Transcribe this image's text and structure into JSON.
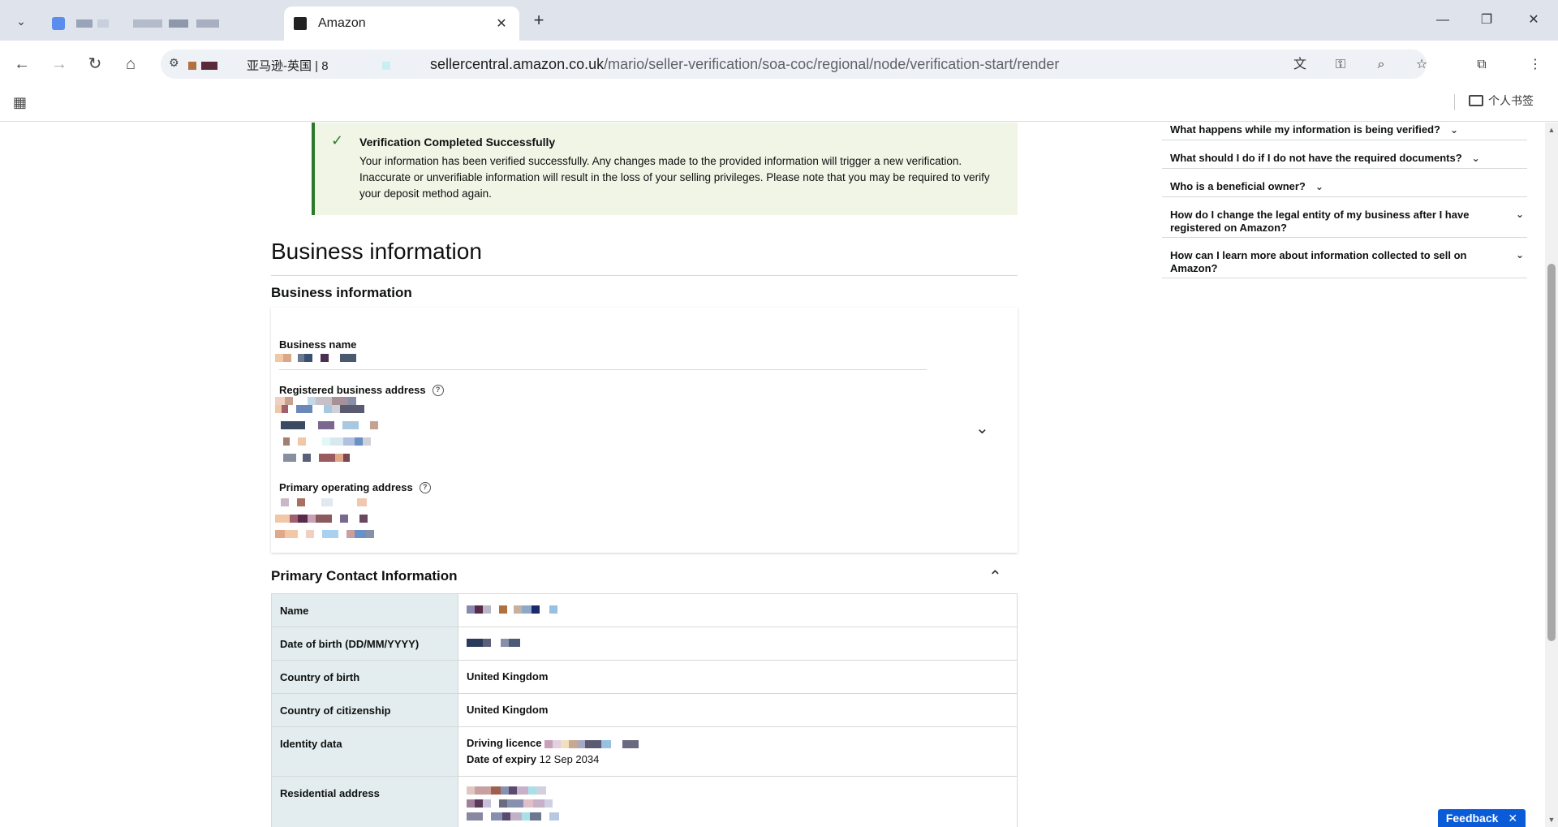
{
  "browser": {
    "active_tab_title": "Amazon",
    "site_chip": "亚马逊-英国 | 8",
    "url_host": "sellercentral.amazon.co.uk",
    "url_path": "/mario/seller-verification/soa-coc/regional/node/verification-start/render",
    "bookmark_folder": "个人书签"
  },
  "alert": {
    "title": "Verification Completed Successfully",
    "body": "Your information has been verified successfully. Any changes made to the provided information will trigger a new verification. Inaccurate or unverifiable information will result in the loss of your selling privileges. Please note that you may be required to verify your deposit method again."
  },
  "business": {
    "heading": "Business information",
    "subheading": "Business information",
    "name_label": "Business name",
    "registered_label": "Registered business address",
    "operating_label": "Primary operating address"
  },
  "contact": {
    "heading": "Primary Contact Information",
    "rows": [
      {
        "label": "Name",
        "value": ""
      },
      {
        "label": "Date of birth (DD/MM/YYYY)",
        "value": ""
      },
      {
        "label": "Country of birth",
        "value": "United Kingdom"
      },
      {
        "label": "Country of citizenship",
        "value": "United Kingdom"
      },
      {
        "label": "Identity data",
        "value": ""
      },
      {
        "label": "Residential address",
        "value": ""
      }
    ],
    "identity_type_label": "Driving licence",
    "expiry_label": "Date of expiry",
    "expiry_value": "12 Sep 2034"
  },
  "faq": [
    "What happens while my information is being verified?",
    "What should I do if I do not have the required documents?",
    "Who is a beneficial owner?",
    "How do I change the legal entity of my business after I have registered on Amazon?",
    "How can I learn more about information collected to sell on Amazon?"
  ],
  "feedback_label": "Feedback",
  "icons": {
    "success": "check-icon",
    "help": "help-circle-icon",
    "expand": "chevron-down-icon",
    "collapse": "chevron-up-icon"
  }
}
